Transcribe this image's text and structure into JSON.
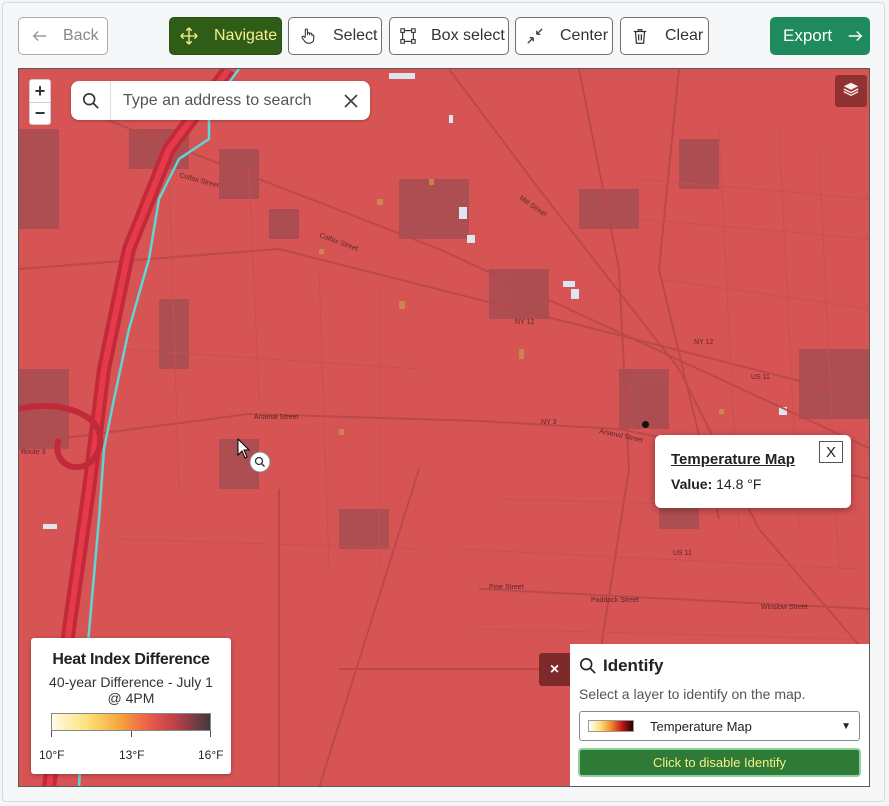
{
  "toolbar": {
    "back_label": "Back",
    "navigate_label": "Navigate",
    "select_label": "Select",
    "box_select_label": "Box select",
    "center_label": "Center",
    "clear_label": "Clear",
    "export_label": "Export",
    "active_tool": "Navigate",
    "colors": {
      "navigate_bg": "#2f5d18",
      "navigate_text": "#f5f08a",
      "export_bg": "#1f8a5d"
    }
  },
  "map": {
    "zoom_in": "+",
    "zoom_out": "−",
    "search_placeholder": "Type an address to search",
    "labels": {
      "colfax": "Colfax Street",
      "colfax2": "Colfax Street",
      "arsenal_w": "Arsenal Street",
      "arsenal_e": "Arsenal Street",
      "ny3": "NY 3",
      "ny12": "NY 12",
      "ny12b": "NY 12",
      "route3": "Route 3",
      "paddock": "Paddock Street",
      "winslow": "Winslow Street",
      "pine": "Pine Street",
      "mill": "Mill Street",
      "us11": "US 11",
      "us11b": "US 11"
    }
  },
  "popup": {
    "title": "Temperature Map",
    "value_label": "Value:",
    "value": "14.8 °F",
    "close_label": "X"
  },
  "legend": {
    "title": "Heat Index Difference",
    "subtitle_line1": "40-year Difference - July 1",
    "subtitle_line2": "@ 4PM",
    "min_label": "10°F",
    "mid_label": "13°F",
    "max_label": "16°F"
  },
  "identify": {
    "close_label": "×",
    "title": "Identify",
    "description": "Select a layer to identify on the map.",
    "selected_layer": "Temperature Map",
    "disable_button_label": "Click to disable Identify"
  }
}
